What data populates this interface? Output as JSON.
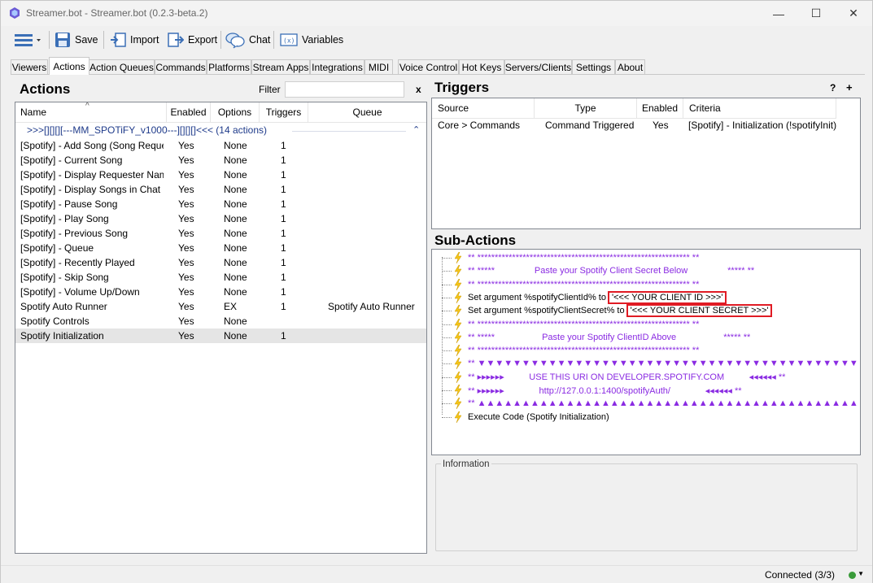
{
  "window": {
    "title": "Streamer.bot - Streamer.bot (0.2.3-beta.2)",
    "minimize": "—",
    "maximize": "☐",
    "close": "✕"
  },
  "toolbar": {
    "menu_icon": "hamburger-menu-icon",
    "save": "Save",
    "import": "Import",
    "export": "Export",
    "chat": "Chat",
    "variables": "Variables"
  },
  "tabs": [
    "Viewers",
    "Actions",
    "Action Queues",
    "Commands",
    "Platforms",
    "Stream Apps",
    "Integrations",
    "MIDI",
    "Voice Control",
    "Hot Keys",
    "Servers/Clients",
    "Settings",
    "About"
  ],
  "actions_panel": {
    "title": "Actions",
    "filter_label": "Filter",
    "filter_value": "",
    "filter_clear": "x",
    "columns": [
      "Name",
      "Enabled",
      "Options",
      "Triggers",
      "Queue"
    ],
    "group": {
      "label": ">>>[][][][---MM_SPOTiFY_v1000---][][][]<<< (14 actions)",
      "chevron": "⌃"
    },
    "rows": [
      {
        "name": "[Spotify] - Add Song (Song Reque...",
        "enabled": "Yes",
        "options": "None",
        "triggers": "1",
        "queue": ""
      },
      {
        "name": "[Spotify] - Current Song",
        "enabled": "Yes",
        "options": "None",
        "triggers": "1",
        "queue": ""
      },
      {
        "name": "[Spotify] - Display Requester Nam...",
        "enabled": "Yes",
        "options": "None",
        "triggers": "1",
        "queue": ""
      },
      {
        "name": "[Spotify] - Display Songs in Chat",
        "enabled": "Yes",
        "options": "None",
        "triggers": "1",
        "queue": ""
      },
      {
        "name": "[Spotify] - Pause Song",
        "enabled": "Yes",
        "options": "None",
        "triggers": "1",
        "queue": ""
      },
      {
        "name": "[Spotify] - Play Song",
        "enabled": "Yes",
        "options": "None",
        "triggers": "1",
        "queue": ""
      },
      {
        "name": "[Spotify] - Previous Song",
        "enabled": "Yes",
        "options": "None",
        "triggers": "1",
        "queue": ""
      },
      {
        "name": "[Spotify] - Queue",
        "enabled": "Yes",
        "options": "None",
        "triggers": "1",
        "queue": ""
      },
      {
        "name": "[Spotify] - Recently Played",
        "enabled": "Yes",
        "options": "None",
        "triggers": "1",
        "queue": ""
      },
      {
        "name": "[Spotify] - Skip Song",
        "enabled": "Yes",
        "options": "None",
        "triggers": "1",
        "queue": ""
      },
      {
        "name": "[Spotify] - Volume Up/Down",
        "enabled": "Yes",
        "options": "None",
        "triggers": "1",
        "queue": ""
      },
      {
        "name": "Spotify Auto Runner",
        "enabled": "Yes",
        "options": "EX",
        "triggers": "1",
        "queue": "Spotify Auto Runner"
      },
      {
        "name": "Spotify Controls",
        "enabled": "Yes",
        "options": "None",
        "triggers": "",
        "queue": ""
      },
      {
        "name": "Spotify Initialization",
        "enabled": "Yes",
        "options": "None",
        "triggers": "1",
        "queue": ""
      }
    ]
  },
  "triggers_panel": {
    "title": "Triggers",
    "help": "?",
    "add": "+",
    "columns": [
      "Source",
      "Type",
      "Enabled",
      "Criteria"
    ],
    "rows": [
      {
        "source": "Core > Commands",
        "type": "Command Triggered",
        "enabled": "Yes",
        "criteria": "[Spotify] - Initialization (!spotifyInit)"
      }
    ]
  },
  "subactions_panel": {
    "title": "Sub-Actions",
    "lines": [
      {
        "text": "** ************************************************************* **",
        "color": "purple",
        "hl": ""
      },
      {
        "text": "** *****                Paste your Spotify Client Secret Below                ***** **",
        "color": "purple",
        "hl": ""
      },
      {
        "text": "** ************************************************************* **",
        "color": "purple",
        "hl": ""
      },
      {
        "text": "Set argument %spotifyClientId% to",
        "color": "black",
        "hl": "'<<< YOUR CLIENT ID >>>'"
      },
      {
        "text": "Set argument %spotifyClientSecret% to",
        "color": "black",
        "hl": "'<<< YOUR CLIENT SECRET >>>'"
      },
      {
        "text": "** ************************************************************* **",
        "color": "purple",
        "hl": ""
      },
      {
        "text": "** *****                   Paste your Spotify ClientID Above                   ***** **",
        "color": "purple",
        "hl": ""
      },
      {
        "text": "** ************************************************************* **",
        "color": "purple",
        "hl": ""
      },
      {
        "text": "** ▼▼▼▼▼▼▼▼▼▼▼▼▼▼▼▼▼▼▼▼▼▼▼▼▼▼▼▼▼▼▼▼▼▼▼▼▼▼▼▼▼▼▼▼▼ **",
        "color": "purple",
        "hl": ""
      },
      {
        "text": "** ▸▸▸▸▸▸          USE THIS URI ON DEVELOPER.SPOTIFY.COM          ◂◂◂◂◂◂ **",
        "color": "purple",
        "hl": ""
      },
      {
        "text": "** ▸▸▸▸▸▸              http://127.0.0.1:1400/spotifyAuth/              ◂◂◂◂◂◂ **",
        "color": "purple",
        "hl": ""
      },
      {
        "text": "** ▲▲▲▲▲▲▲▲▲▲▲▲▲▲▲▲▲▲▲▲▲▲▲▲▲▲▲▲▲▲▲▲▲▲▲▲▲▲▲▲▲▲▲▲▲ **",
        "color": "purple",
        "hl": ""
      },
      {
        "text": "Execute Code (Spotify Initialization)",
        "color": "black",
        "hl": ""
      }
    ]
  },
  "information_panel": {
    "title": "Information"
  },
  "statusbar": {
    "text": "Connected (3/3)",
    "dot_color": "#3a9b3a"
  },
  "colors": {
    "accent_purple": "#8a2be2",
    "highlight_red": "#e01b24",
    "group_blue": "#1e3a8a"
  }
}
